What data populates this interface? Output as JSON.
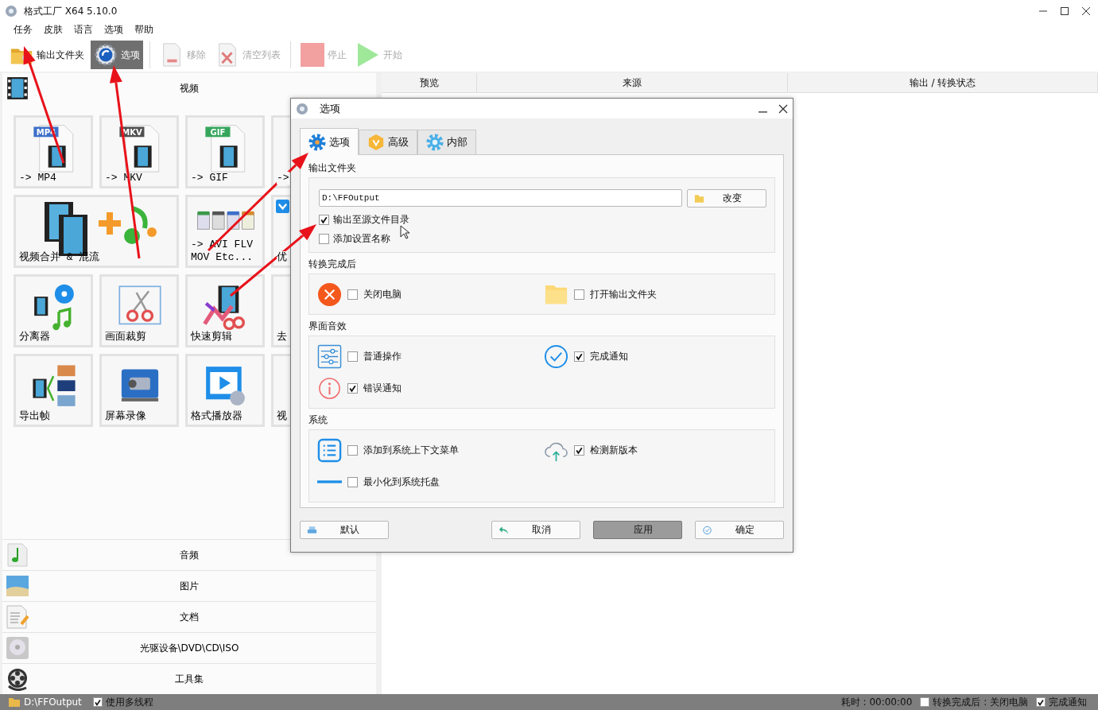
{
  "window": {
    "title": "格式工厂 X64 5.10.0"
  },
  "menu": [
    "任务",
    "皮肤",
    "语言",
    "选项",
    "帮助"
  ],
  "toolbar": [
    {
      "label": "输出文件夹",
      "kind": "folder",
      "selected": false,
      "disabled": false
    },
    {
      "label": "选项",
      "kind": "options",
      "selected": true,
      "disabled": false
    },
    {
      "label": "移除",
      "kind": "remove",
      "selected": false,
      "disabled": true
    },
    {
      "label": "清空列表",
      "kind": "clear",
      "selected": false,
      "disabled": true
    },
    {
      "label": "停止",
      "kind": "stop",
      "selected": false,
      "disabled": true
    },
    {
      "label": "开始",
      "kind": "start",
      "selected": false,
      "disabled": true
    }
  ],
  "categories": [
    {
      "label": "视频",
      "kind": "video",
      "expanded": true,
      "tiles": [
        {
          "label": "-> MP4",
          "kind": "file",
          "badge": "MP4"
        },
        {
          "label": "-> MKV",
          "kind": "file",
          "badge": "MKV"
        },
        {
          "label": "-> GIF",
          "kind": "file",
          "badge": "GIF"
        },
        {
          "label": "->",
          "kind": "partial"
        },
        {
          "label": "视频合并 & 混流",
          "kind": "merge"
        },
        {
          "label": "-> AVI FLV MOV Etc...",
          "kind": "formats"
        },
        {
          "label": "优",
          "kind": "partial_badge"
        },
        {
          "label": "分离器",
          "kind": "splitter"
        },
        {
          "label": "画面裁剪",
          "kind": "crop"
        },
        {
          "label": "快速剪辑",
          "kind": "quickcut"
        },
        {
          "label": "去",
          "kind": "partial"
        },
        {
          "label": "导出帧",
          "kind": "frames"
        },
        {
          "label": "屏幕录像",
          "kind": "recorder"
        },
        {
          "label": "格式播放器",
          "kind": "player"
        },
        {
          "label": "视",
          "kind": "partial"
        }
      ]
    },
    {
      "label": "音频",
      "kind": "audio",
      "expanded": false
    },
    {
      "label": "图片",
      "kind": "image",
      "expanded": false
    },
    {
      "label": "文档",
      "kind": "document",
      "expanded": false
    },
    {
      "label": "光驱设备\\DVD\\CD\\ISO",
      "kind": "disc",
      "expanded": false
    },
    {
      "label": "工具集",
      "kind": "tools",
      "expanded": false
    }
  ],
  "task_table": {
    "columns": [
      "预览",
      "来源",
      "输出 / 转换状态"
    ]
  },
  "dialog": {
    "title": "选项",
    "tabs": [
      {
        "label": "选项",
        "kind": "gear",
        "selected": true
      },
      {
        "label": "高级",
        "kind": "badge",
        "selected": false
      },
      {
        "label": "内部",
        "kind": "gear_light",
        "selected": false
      }
    ],
    "output_folder": {
      "heading": "输出文件夹",
      "path": "D:\\FFOutput",
      "change_button": "改变",
      "options": [
        {
          "label": "输出至源文件目录",
          "checked": true
        },
        {
          "label": "添加设置名称",
          "checked": false
        }
      ]
    },
    "sections": [
      {
        "heading": "转换完成后",
        "items": [
          {
            "label": "关闭电脑",
            "kind": "shutdown",
            "checked": false
          },
          {
            "label": "打开输出文件夹",
            "kind": "folder",
            "checked": false
          }
        ]
      },
      {
        "heading": "界面音效",
        "items": [
          {
            "label": "普通操作",
            "kind": "sliders",
            "checked": false
          },
          {
            "label": "完成通知",
            "kind": "check",
            "checked": true
          },
          {
            "label": "错误通知",
            "kind": "info",
            "checked": true
          }
        ]
      },
      {
        "heading": "系统",
        "items": [
          {
            "label": "添加到系统上下文菜单",
            "kind": "list",
            "checked": false
          },
          {
            "label": "检测新版本",
            "kind": "cloud",
            "checked": true
          },
          {
            "label": "最小化到系统托盘",
            "kind": "minimize",
            "checked": false
          }
        ]
      }
    ],
    "buttons": [
      {
        "label": "默认",
        "kind": "printer",
        "selected": false
      },
      {
        "label": "取消",
        "kind": "undo",
        "selected": false
      },
      {
        "label": "应用",
        "kind": "apply",
        "selected": true
      },
      {
        "label": "确定",
        "kind": "ok",
        "selected": false
      }
    ]
  },
  "status_bar": {
    "path": "D:\\FFOutput",
    "multithread": {
      "label": "使用多线程",
      "checked": true
    },
    "elapsed": "耗时 : 00:00:00",
    "after_convert": {
      "label": "转换完成后 : 关闭电脑",
      "checked": false
    },
    "notify": {
      "label": "完成通知",
      "checked": true
    }
  }
}
